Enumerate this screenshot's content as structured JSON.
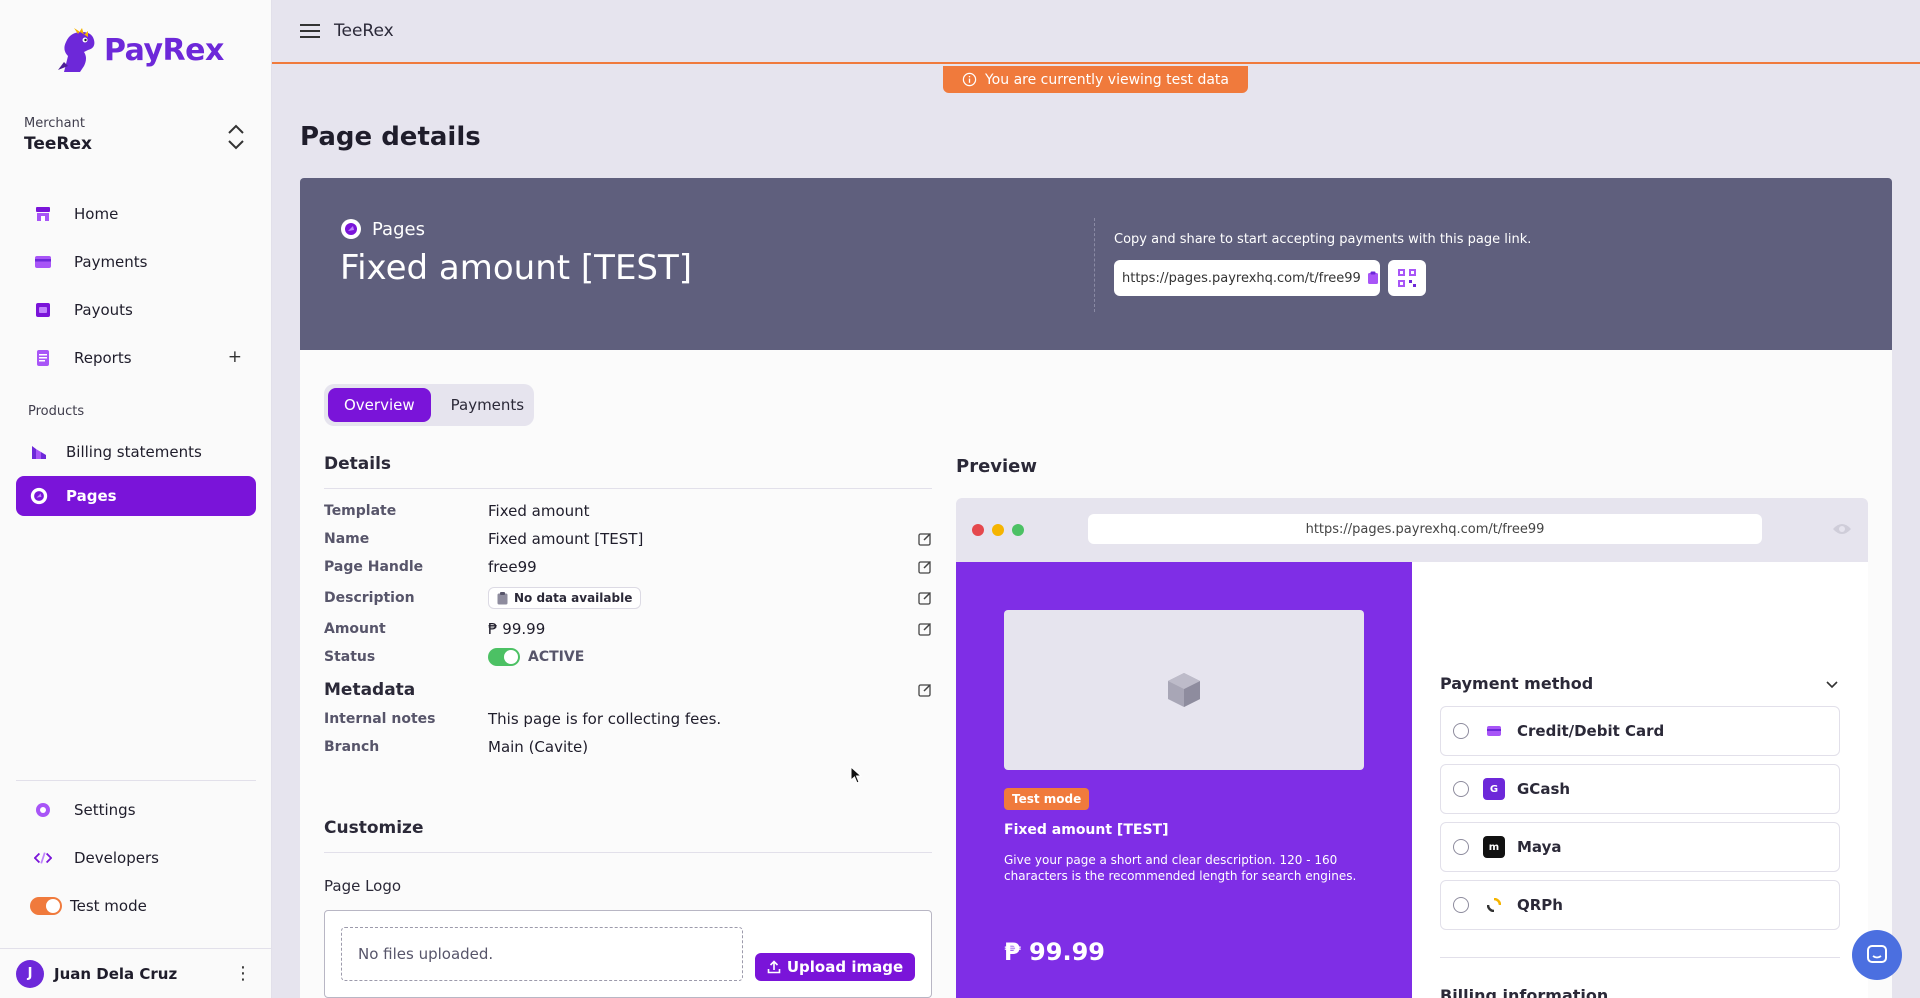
{
  "brand": {
    "name": "PayRex",
    "color": "#6d28d9"
  },
  "merchant": {
    "caption": "Merchant",
    "name": "TeeRex"
  },
  "nav": {
    "items": [
      {
        "label": "Home",
        "icon": "store-icon"
      },
      {
        "label": "Payments",
        "icon": "card-icon"
      },
      {
        "label": "Payouts",
        "icon": "wallet-icon"
      },
      {
        "label": "Reports",
        "icon": "report-icon"
      }
    ],
    "reports_plus": "+",
    "products_label": "Products",
    "products": [
      {
        "label": "Billing statements",
        "icon": "billing-icon"
      },
      {
        "label": "Pages",
        "icon": "pages-icon",
        "active": true
      }
    ],
    "bottom": [
      {
        "label": "Settings",
        "icon": "gear-icon"
      },
      {
        "label": "Developers",
        "icon": "code-icon"
      }
    ],
    "test_mode_label": "Test mode"
  },
  "user": {
    "initial": "J",
    "name": "Juan Dela Cruz"
  },
  "topbar": {
    "title": "TeeRex"
  },
  "banner": {
    "text": "You are currently viewing test data"
  },
  "page": {
    "title": "Page details"
  },
  "header": {
    "label": "Pages",
    "title": "Fixed amount [TEST]",
    "share_text": "Copy and share to start accepting payments with this page link.",
    "link": "https://pages.payrexhq.com/t/free99"
  },
  "tabs": {
    "overview": "Overview",
    "payments": "Payments"
  },
  "details": {
    "title": "Details",
    "rows": [
      {
        "k": "Template",
        "v": "Fixed amount"
      },
      {
        "k": "Name",
        "v": "Fixed amount [TEST]"
      },
      {
        "k": "Page Handle",
        "v": "free99"
      },
      {
        "k": "Description",
        "v": "No data available"
      },
      {
        "k": "Amount",
        "v": "₱ 99.99"
      },
      {
        "k": "Status",
        "v": "ACTIVE"
      }
    ]
  },
  "metadata": {
    "title": "Metadata",
    "rows": [
      {
        "k": "Internal notes",
        "v": "This page is for collecting fees."
      },
      {
        "k": "Branch",
        "v": "Main (Cavite)"
      }
    ]
  },
  "customize": {
    "title": "Customize",
    "logo_label": "Page Logo",
    "dropzone_text": "No files uploaded.",
    "upload_label": "Upload image"
  },
  "preview": {
    "title": "Preview",
    "url": "https://pages.payrexhq.com/t/free99",
    "test_badge": "Test mode",
    "page_title": "Fixed amount [TEST]",
    "description": "Give your page a short and clear description. 120 - 160 characters is the recommended length for search engines.",
    "amount": "₱ 99.99",
    "payment_method_title": "Payment method",
    "methods": [
      "Credit/Debit Card",
      "GCash",
      "Maya",
      "QRPh"
    ],
    "billing_peek": "Billing information"
  },
  "colors": {
    "accent": "#7a14d9",
    "orange": "#f07a3c",
    "header": "#5f5f7d",
    "active_green": "#4cc164"
  }
}
